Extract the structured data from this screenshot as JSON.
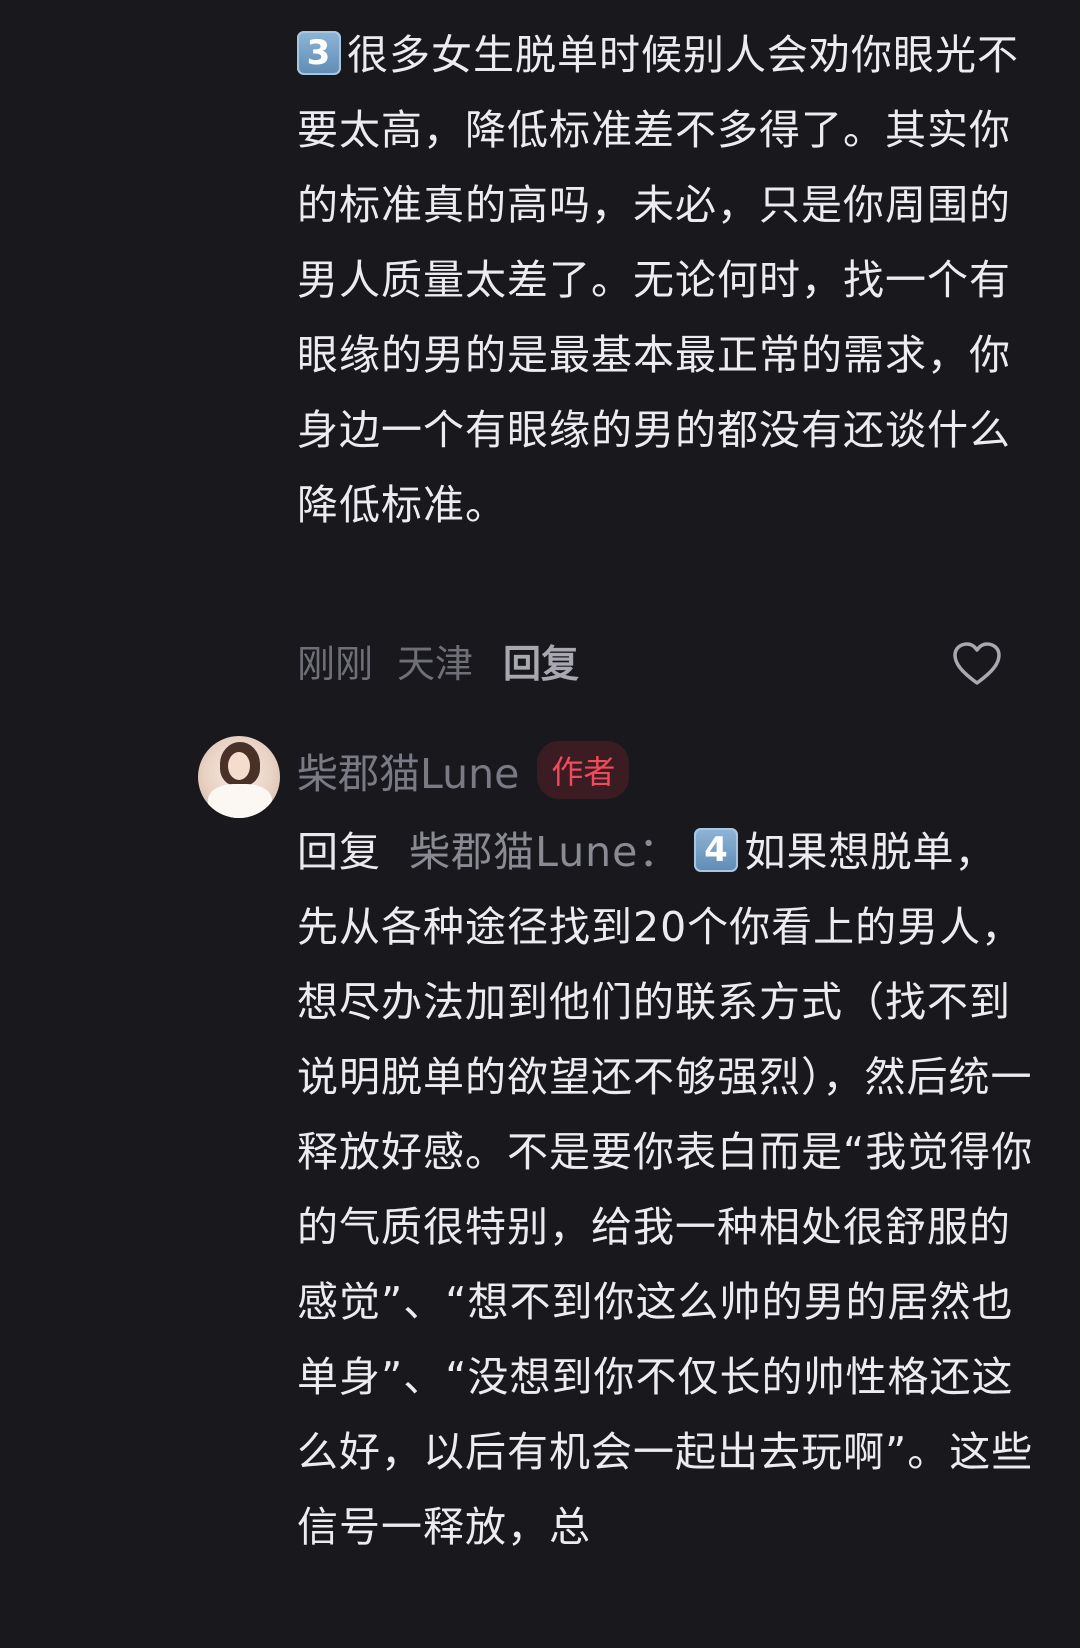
{
  "comment_one": {
    "badge": "3",
    "text": "很多女生脱单时候别人会劝你眼光不要太高，降低标准差不多得了。其实你的标准真的高吗，未必，只是你周围的男人质量太差了。无论何时，找一个有眼缘的男的是最基本最正常的需求，你身边一个有眼缘的男的都没有还谈什么降低标准。",
    "time": "刚刚",
    "location": "天津",
    "reply_label": "回复"
  },
  "comment_two": {
    "author": "柴郡猫Lune",
    "author_badge": "作者",
    "reply_prefix": "回复",
    "reply_target": "柴郡猫Lune：",
    "badge": "4",
    "text": "如果想脱单，先从各种途径找到20个你看上的男人，想尽办法加到他们的联系方式（找不到说明脱单的欲望还不够强烈），然后统一释放好感。不是要你表白而是“我觉得你的气质很特别，给我一种相处很舒服的感觉”、“想不到你这么帅的男的居然也单身”、“没想到你不仅长的帅性格还这么好，以后有机会一起出去玩啊”。这些信号一释放，总"
  },
  "icons": {
    "like": "heart-outline-icon",
    "badge_color": "#5e8cb5",
    "author_badge_color": "#f04a5c"
  }
}
